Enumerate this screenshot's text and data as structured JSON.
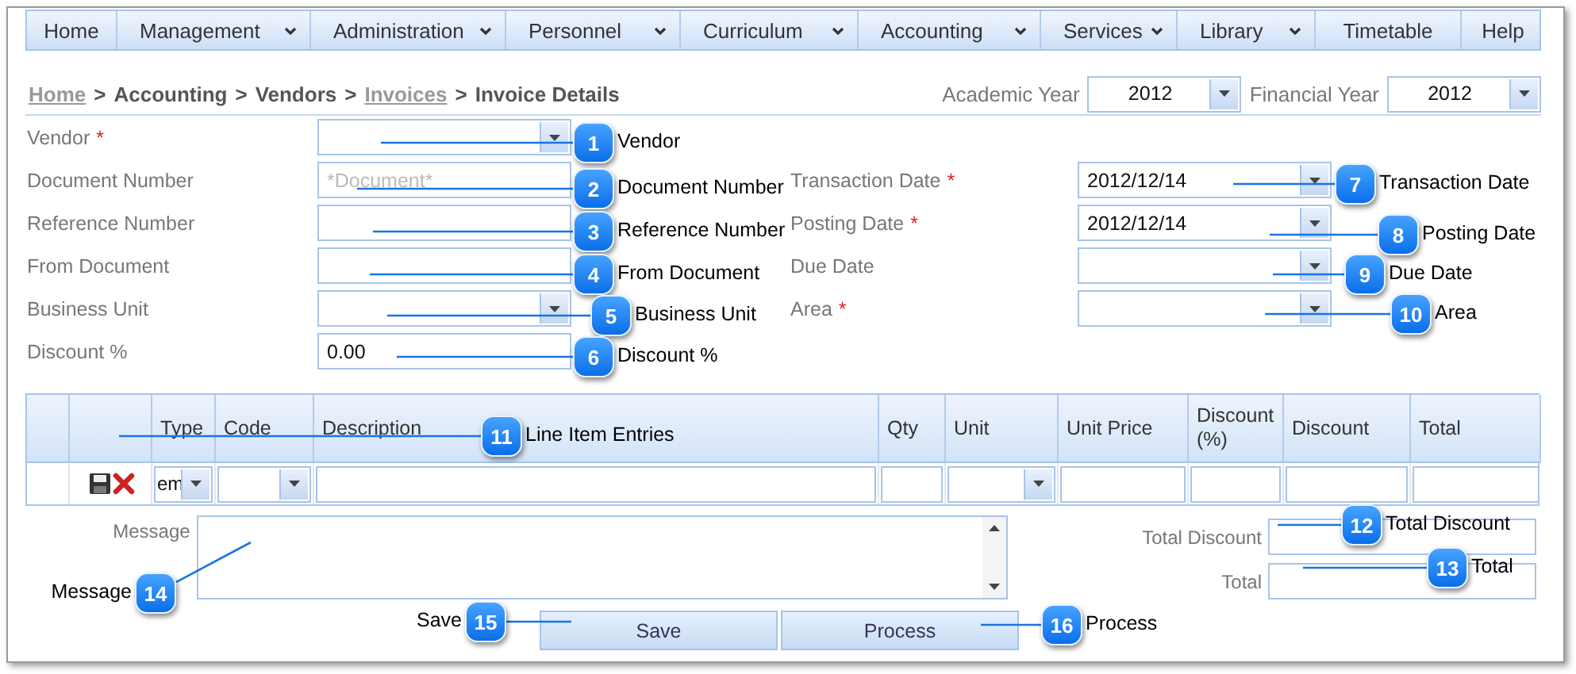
{
  "nav": [
    {
      "label": "Home",
      "menu": false
    },
    {
      "label": "Management",
      "menu": true
    },
    {
      "label": "Administration",
      "menu": true
    },
    {
      "label": "Personnel",
      "menu": true
    },
    {
      "label": "Curriculum",
      "menu": true
    },
    {
      "label": "Accounting",
      "menu": true
    },
    {
      "label": "Services",
      "menu": true
    },
    {
      "label": "Library",
      "menu": true
    },
    {
      "label": "Timetable",
      "menu": false
    },
    {
      "label": "Help",
      "menu": false
    }
  ],
  "breadcrumb": [
    {
      "kind": "link",
      "text": "Home"
    },
    {
      "kind": "sep",
      "text": ">"
    },
    {
      "kind": "crumb",
      "text": "Accounting"
    },
    {
      "kind": "sep",
      "text": ">"
    },
    {
      "kind": "crumb",
      "text": "Vendors"
    },
    {
      "kind": "sep",
      "text": ">"
    },
    {
      "kind": "link",
      "text": "Invoices"
    },
    {
      "kind": "sep",
      "text": ">"
    },
    {
      "kind": "crumb",
      "text": "Invoice Details"
    }
  ],
  "years": [
    {
      "label": "Academic Year",
      "value": "2012"
    },
    {
      "label": "Financial Year",
      "value": "2012"
    }
  ],
  "form_left": [
    {
      "label": "Vendor",
      "required_mark": "*",
      "kind": "select"
    },
    {
      "label": "Document Number",
      "kind": "text",
      "placeholder": "*Document*"
    },
    {
      "label": "Reference Number",
      "kind": "text"
    },
    {
      "label": "From Document",
      "kind": "text"
    },
    {
      "label": "Business Unit",
      "kind": "select"
    },
    {
      "label": "Discount %",
      "kind": "text",
      "value": "0.00"
    }
  ],
  "form_right": [
    {
      "label": "Transaction Date",
      "required_mark": "*",
      "kind": "select",
      "value": "2012/12/14"
    },
    {
      "label": "Posting Date",
      "required_mark": "*",
      "kind": "select",
      "value": "2012/12/14"
    },
    {
      "label": "Due Date",
      "kind": "select"
    },
    {
      "label": "Area",
      "required_mark": "*",
      "kind": "select"
    }
  ],
  "table": {
    "columns": [
      {
        "label": "Type",
        "kind": "select",
        "value": "em"
      },
      {
        "label": "Code",
        "kind": "select"
      },
      {
        "label": "Description",
        "kind": "text"
      },
      {
        "label": "Qty",
        "kind": "text"
      },
      {
        "label": "Unit",
        "kind": "select"
      },
      {
        "label": "Unit Price",
        "kind": "text"
      },
      {
        "label": "Discount (%)",
        "kind": "text"
      },
      {
        "label": "Discount",
        "kind": "text"
      },
      {
        "label": "Total",
        "kind": "text"
      }
    ]
  },
  "message": {
    "label": "Message"
  },
  "totals": [
    {
      "label": "Total Discount"
    },
    {
      "label": "Total"
    }
  ],
  "buttons": [
    "Save",
    "Process"
  ],
  "callouts": [
    {
      "number": "1",
      "text": "Vendor"
    },
    {
      "number": "2",
      "text": "Document Number"
    },
    {
      "number": "3",
      "text": "Reference Number"
    },
    {
      "number": "4",
      "text": "From Document"
    },
    {
      "number": "5",
      "text": "Business Unit"
    },
    {
      "number": "6",
      "text": "Discount %"
    },
    {
      "number": "7",
      "text": "Transaction Date"
    },
    {
      "number": "8",
      "text": "Posting Date"
    },
    {
      "number": "9",
      "text": "Due Date"
    },
    {
      "number": "10",
      "text": "Area"
    },
    {
      "number": "11",
      "text": "Line Item Entries"
    },
    {
      "number": "12",
      "text": "Total Discount"
    },
    {
      "number": "13",
      "text": "Total"
    },
    {
      "number": "14",
      "text": "Message"
    },
    {
      "number": "15",
      "text": "Save"
    },
    {
      "number": "16",
      "text": "Process"
    }
  ]
}
